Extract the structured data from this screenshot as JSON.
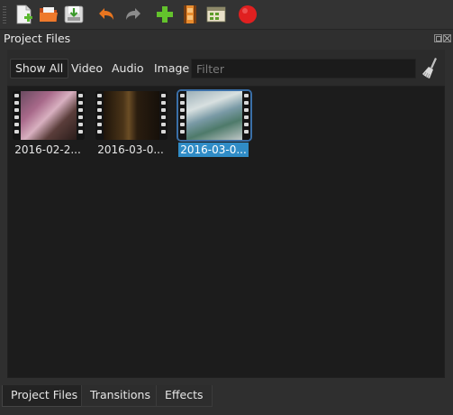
{
  "toolbar": {
    "buttons": [
      {
        "name": "new-project-icon"
      },
      {
        "name": "open-project-icon"
      },
      {
        "name": "save-project-icon"
      },
      {
        "name": "undo-icon"
      },
      {
        "name": "redo-icon"
      },
      {
        "name": "import-files-icon"
      },
      {
        "name": "choose-profile-icon"
      },
      {
        "name": "fullscreen-icon"
      },
      {
        "name": "export-video-icon"
      }
    ]
  },
  "panel": {
    "title": "Project Files",
    "filters": {
      "show_all": "Show All",
      "video": "Video",
      "audio": "Audio",
      "image": "Image"
    },
    "filter_placeholder": "Filter",
    "files": [
      {
        "label": "2016-02-2...",
        "selected": false
      },
      {
        "label": "2016-03-0...",
        "selected": false
      },
      {
        "label": "2016-03-0...",
        "selected": true
      }
    ]
  },
  "tabs": {
    "project_files": "Project Files",
    "transitions": "Transitions",
    "effects": "Effects"
  },
  "colors": {
    "background": "#2f2f2f",
    "files_area": "#1c1c1c",
    "selection": "#308cc6",
    "record_red": "#e02020"
  }
}
